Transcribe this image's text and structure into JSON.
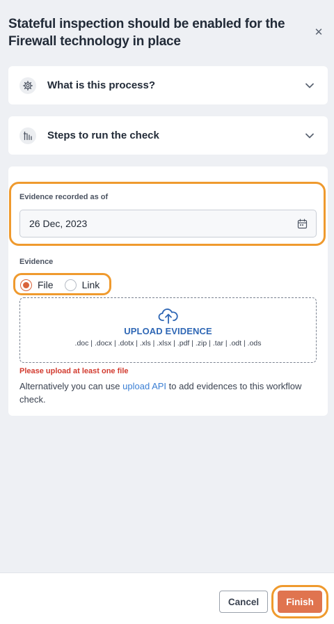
{
  "dialog": {
    "title": "Stateful inspection should be enabled for the Firewall technology in place",
    "close_icon": "close-icon"
  },
  "accordions": [
    {
      "label": "What is this process?",
      "icon": "gear-icon",
      "expanded": false
    },
    {
      "label": "Steps to run the check",
      "icon": "steps-icon",
      "expanded": false
    }
  ],
  "evidence_form": {
    "date_label": "Evidence recorded as of",
    "date_value": "26 Dec, 2023",
    "date_icon": "calendar-icon",
    "evidence_label": "Evidence",
    "options": [
      {
        "label": "File",
        "selected": true
      },
      {
        "label": "Link",
        "selected": false
      }
    ],
    "upload": {
      "icon": "cloud-upload-icon",
      "title": "UPLOAD EVIDENCE",
      "types": ".doc | .docx | .dotx | .xls | .xlsx | .pdf | .zip | .tar | .odt | .ods"
    },
    "error": "Please upload at least one file",
    "note": {
      "before": "Alternatively you can use ",
      "link": "upload API",
      "after": " to add evidences to this workflow check."
    }
  },
  "footer": {
    "cancel_label": "Cancel",
    "finish_label": "Finish"
  },
  "colors": {
    "accent": "#e0744f",
    "highlight": "#ef9a2e",
    "link": "#3b7fd4",
    "upload_title": "#2f67b5",
    "error": "#d23b2f"
  }
}
